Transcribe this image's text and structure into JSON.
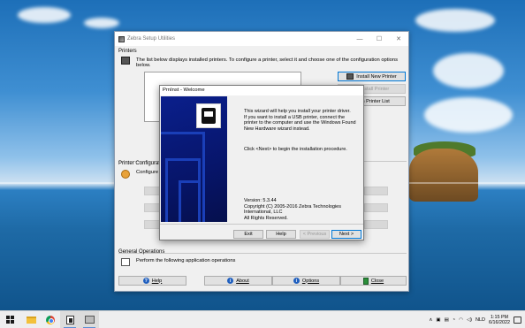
{
  "app": {
    "title": "Zebra Setup Utilities",
    "printers_section": "Printers",
    "printers_desc": "The list below displays installed printers. To configure a printer, select it and choose one of the configuration options below.",
    "install_button": "Install New Printer",
    "uninstall_button": "Uninstall Printer",
    "refresh_button": "fresh Printer List",
    "config_section": "Printer Configuration",
    "config_desc": "Configure t",
    "general_section": "General Operations",
    "general_desc": "Perform the following application operations",
    "help_button": "Help",
    "about_button": "About",
    "options_button": "Options",
    "close_button": "Close"
  },
  "dialog": {
    "title": "PrnInst - Welcome",
    "intro": "This wizard will help you install your printer driver.\nIf you want to install a USB printer, connect the printer to the computer and use the Windows Found New Hardware wizard instead.",
    "click_next": "Click <Next> to begin the installation procedure.",
    "version": "Version: 5.3.44\nCopyright (C) 2005-2016 Zebra Technologies International, LLC\nAll Rights Reserved.",
    "exit_button": "Exit",
    "help_button": "Help",
    "previous_button": "< Previous",
    "next_button": "Next >"
  },
  "taskbar": {
    "language": "NLD",
    "time": "1:15 PM",
    "date": "6/16/2022"
  },
  "icons": [
    "windows-logo-icon",
    "file-explorer-icon",
    "chrome-icon",
    "zebra-setup-icon",
    "printer-app-icon",
    "chevron-up-icon",
    "network-icon",
    "volume-icon",
    "notification-icon"
  ]
}
